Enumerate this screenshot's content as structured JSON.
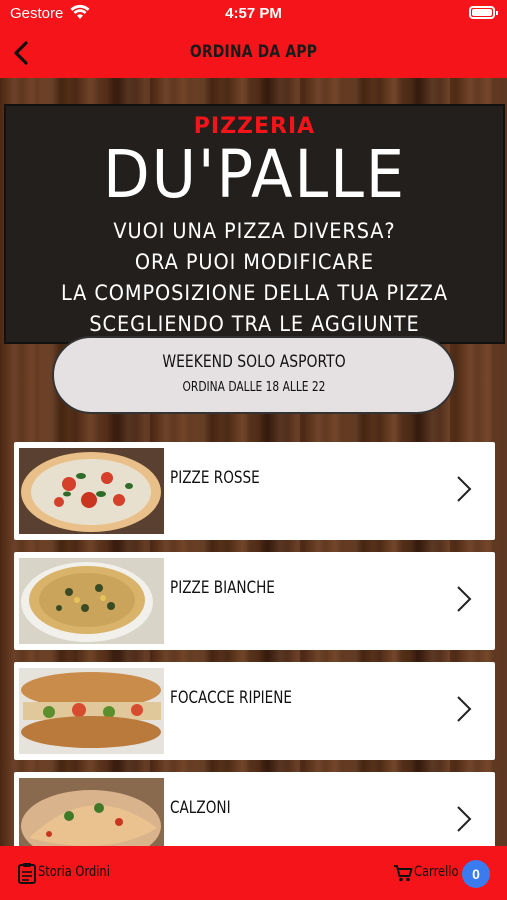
{
  "status_bar": {
    "carrier": "Gestore",
    "time": "4:57 PM"
  },
  "nav": {
    "title": "ORDINA DA APP"
  },
  "banner": {
    "brand_small": "PIZZERIA",
    "brand_big": "DU'PALLE",
    "promo_lines": [
      "VUOI UNA PIZZA DIVERSA?",
      "ORA PUOI MODIFICARE",
      "LA COMPOSIZIONE DELLA TUA PIZZA",
      "SCEGLIENDO TRA LE AGGIUNTE"
    ]
  },
  "notice": {
    "title": "WEEKEND SOLO ASPORTO",
    "subtitle": "ORDINA DALLE 18 ALLE 22"
  },
  "categories": [
    {
      "label": "PIZZE ROSSE"
    },
    {
      "label": "PIZZE BIANCHE"
    },
    {
      "label": "FOCACCE RIPIENE"
    },
    {
      "label": "CALZONI"
    }
  ],
  "bottom_bar": {
    "orders_label": "Storia Ordini",
    "cart_label": "Carrello",
    "cart_count": "0"
  },
  "colors": {
    "accent": "#f5141a",
    "badge": "#3a7bf0"
  }
}
